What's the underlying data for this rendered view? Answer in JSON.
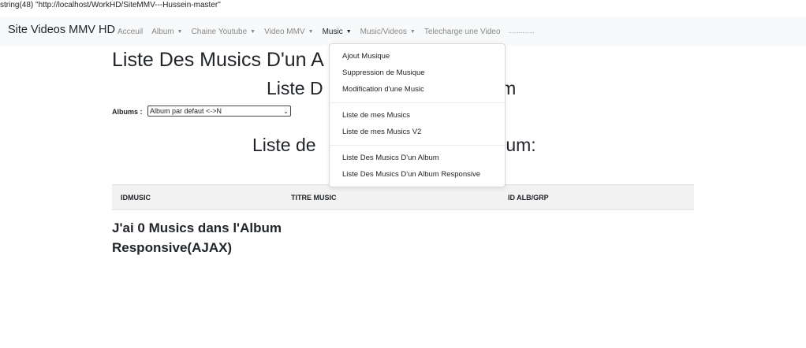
{
  "debug_line": "string(48) \"http://localhost/WorkHD/SiteMMV---Hussein-master\"",
  "navbar": {
    "brand": "Site Videos MMV HD",
    "items": [
      {
        "label": "Acceuil",
        "caret": false,
        "active": false
      },
      {
        "label": "Album",
        "caret": true,
        "active": false
      },
      {
        "label": "Chaine Youtube",
        "caret": true,
        "active": false
      },
      {
        "label": "Video MMV",
        "caret": true,
        "active": false
      },
      {
        "label": "Music",
        "caret": true,
        "active": true
      },
      {
        "label": "Music/Videos",
        "caret": true,
        "active": false
      },
      {
        "label": "Telecharge une Video",
        "caret": false,
        "active": false
      }
    ],
    "trailing": "..............."
  },
  "main": {
    "heading": "Liste Des Musics D'un A",
    "subheading_left": "Liste D",
    "subheading_right": "bum",
    "albums_label": "Albums :",
    "album_select_value": "Album par defaut <->N",
    "list_heading_left": "Liste de",
    "list_heading_right": "bum:",
    "table_headers": [
      "IDMUSIC",
      "TITRE MUSIC",
      "ID ALB/GRP"
    ],
    "count_line1": "J'ai 0 Musics dans l'Album",
    "count_line2": "Responsive(AJAX)"
  },
  "dropdown": {
    "group1": [
      "Ajout Musique",
      "Suppression de Musique",
      "Modification d'une Music"
    ],
    "group2": [
      "Liste de mes Musics",
      "Liste de mes Musics V2"
    ],
    "group3": [
      "Liste Des Musics D'un Album",
      "Liste Des Musics D'un Album Responsive"
    ]
  }
}
